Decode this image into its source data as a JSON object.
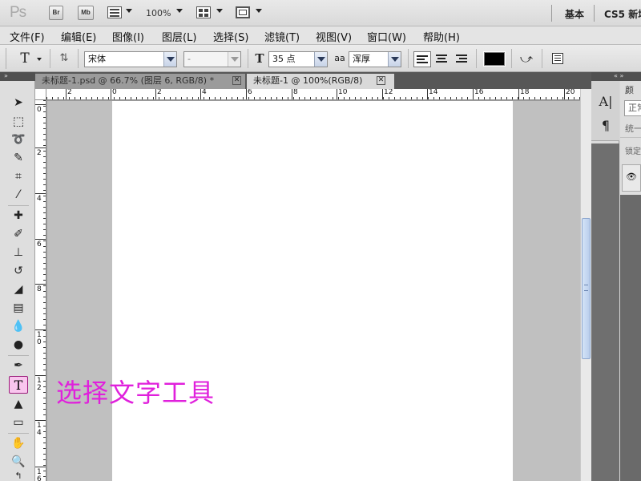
{
  "appbar": {
    "logo": "Ps",
    "bridge_label": "Br",
    "minibridge_label": "Mb",
    "zoom": "100%",
    "workspace_basic": "基本",
    "workspace_new": "CS5 新增"
  },
  "menu": [
    "文件(F)",
    "编辑(E)",
    "图像(I)",
    "图层(L)",
    "选择(S)",
    "滤镜(T)",
    "视图(V)",
    "窗口(W)",
    "帮助(H)"
  ],
  "options": {
    "tool_glyph": "T",
    "font_family": "宋体",
    "font_style": "-",
    "font_size": "35 点",
    "antialias_label": "aa",
    "antialias": "浑厚",
    "text_color": "#000000"
  },
  "panels": {
    "collapse_left": "»",
    "collapse_right": "« »"
  },
  "tabs": [
    {
      "label": "未标题-1.psd @ 66.7% (图层 6, RGB/8) *",
      "active": false
    },
    {
      "label": "未标题-1 @ 100%(RGB/8)",
      "active": true
    }
  ],
  "ruler": {
    "h_labels": [
      "2",
      "0",
      "2",
      "4",
      "6",
      "8",
      "10",
      "12",
      "14",
      "16",
      "18",
      "20"
    ],
    "v_labels": [
      "0",
      "2",
      "4",
      "6",
      "8",
      "1\n0",
      "1\n2",
      "1\n4",
      "1\n6"
    ]
  },
  "annotation": {
    "text": "选择文字工具",
    "color": "#e020dc"
  },
  "right_panel": {
    "char_label": "颜",
    "field_value": "正常",
    "unify_label": "统一",
    "lock_label": "锁定"
  }
}
